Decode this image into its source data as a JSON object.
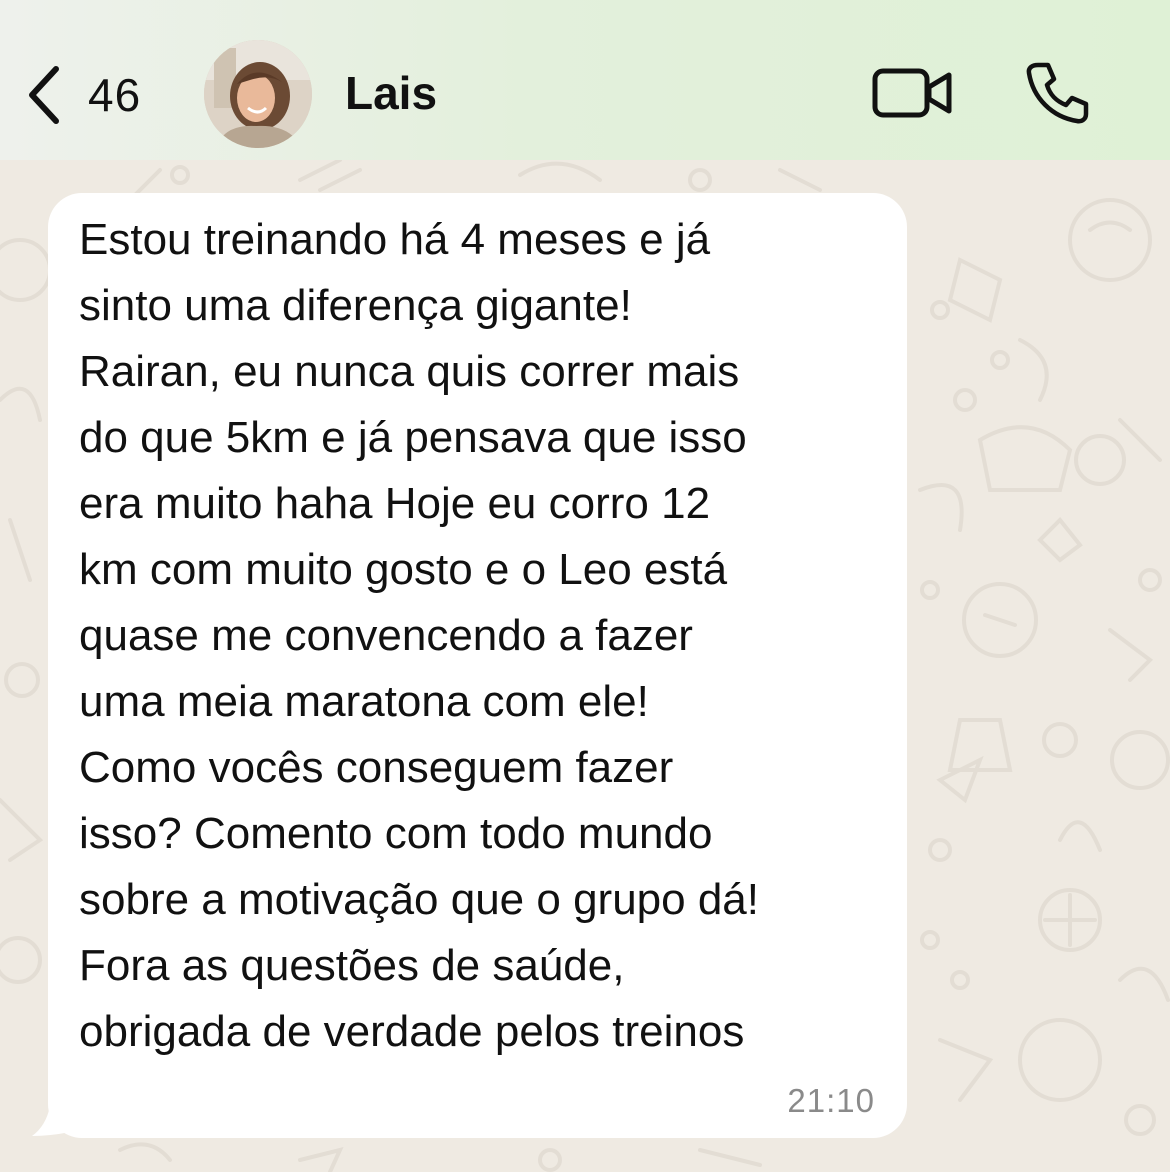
{
  "header": {
    "back_count": "46",
    "contact_name": "Lais",
    "accent_color": "#dff1d6"
  },
  "message": {
    "text": "Estou treinando há 4 meses e já\nsinto uma diferença gigante!\nRairan, eu nunca quis correr mais\ndo que 5km e já pensava que isso\nera muito haha Hoje eu corro 12\nkm com muito gosto e o Leo está\nquase me convencendo a fazer\numa meia maratona com ele!\nComo vocês conseguem fazer\nisso? Comento com todo mundo\nsobre a motivação que o grupo dá!\nFora as questões de saúde,\nobrigada de verdade pelos treinos",
    "time": "21:10"
  },
  "icons": {
    "back": "chevron-left-icon",
    "video": "video-camera-icon",
    "call": "phone-icon"
  }
}
